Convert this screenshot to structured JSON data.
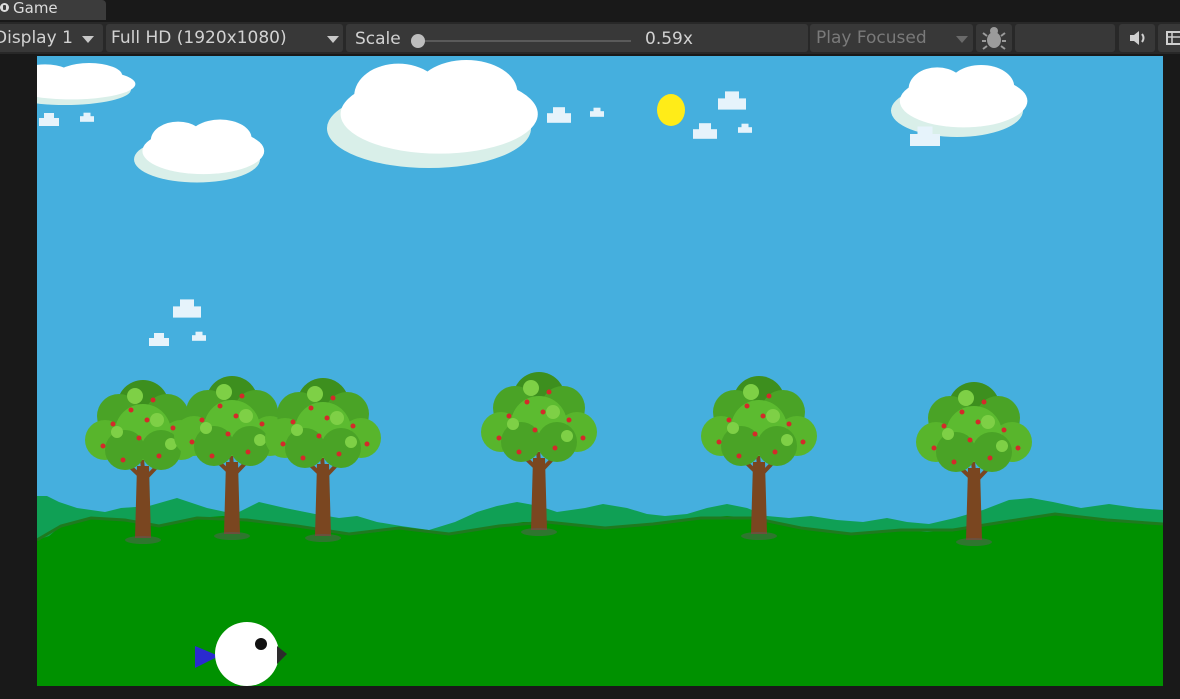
{
  "tab": {
    "title": "Game",
    "icon": "game-controller-icon"
  },
  "toolbar": {
    "display": {
      "value": "Display 1",
      "options": [
        "Display 1"
      ]
    },
    "resolution": {
      "value": "Full HD (1920x1080)"
    },
    "scale": {
      "label": "Scale",
      "value": 0.59,
      "display": "0.59x"
    },
    "play_mode": {
      "value": "Play Focused"
    },
    "icons": [
      "bug-icon",
      "audio-icon",
      "stats-icon"
    ]
  },
  "scene": {
    "sky_color": "#45afde",
    "ground_color": "#009100",
    "hill_color": "#10a055",
    "sun_color": "#ffec18",
    "bird": {
      "body_color": "#ffffff",
      "tail_color": "#2a2ad0",
      "beak_color": "#2c2c2c"
    }
  }
}
